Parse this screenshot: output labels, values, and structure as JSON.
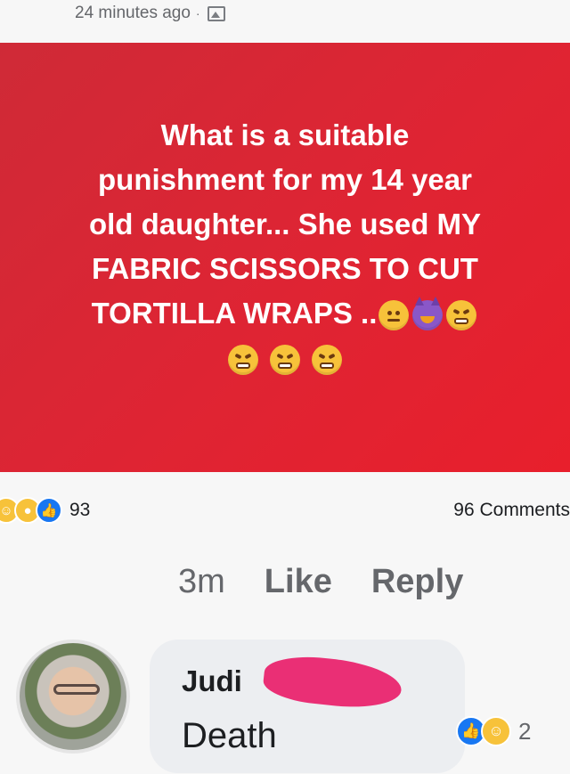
{
  "post": {
    "timestamp": "24 minutes ago",
    "separator": "·",
    "audience_icon": "photo-icon",
    "text_line1": "What is a suitable",
    "text_line2": "punishment for my 14 year",
    "text_line3": "old daughter... She used MY",
    "text_line4": "FABRIC SCISSORS TO CUT",
    "text_line5": "TORTILLA WRAPS ..",
    "background_color": "#e02431"
  },
  "reactions": {
    "icons": [
      "haha-icon",
      "wow-icon",
      "like-icon"
    ],
    "count": "93",
    "comments": "96 Comments"
  },
  "comment_actions": {
    "time": "3m",
    "like_label": "Like",
    "reply_label": "Reply"
  },
  "comment": {
    "author": "Judi",
    "text": "Death",
    "reaction_icons": [
      "like-icon",
      "haha-icon"
    ],
    "reaction_count": "2"
  }
}
